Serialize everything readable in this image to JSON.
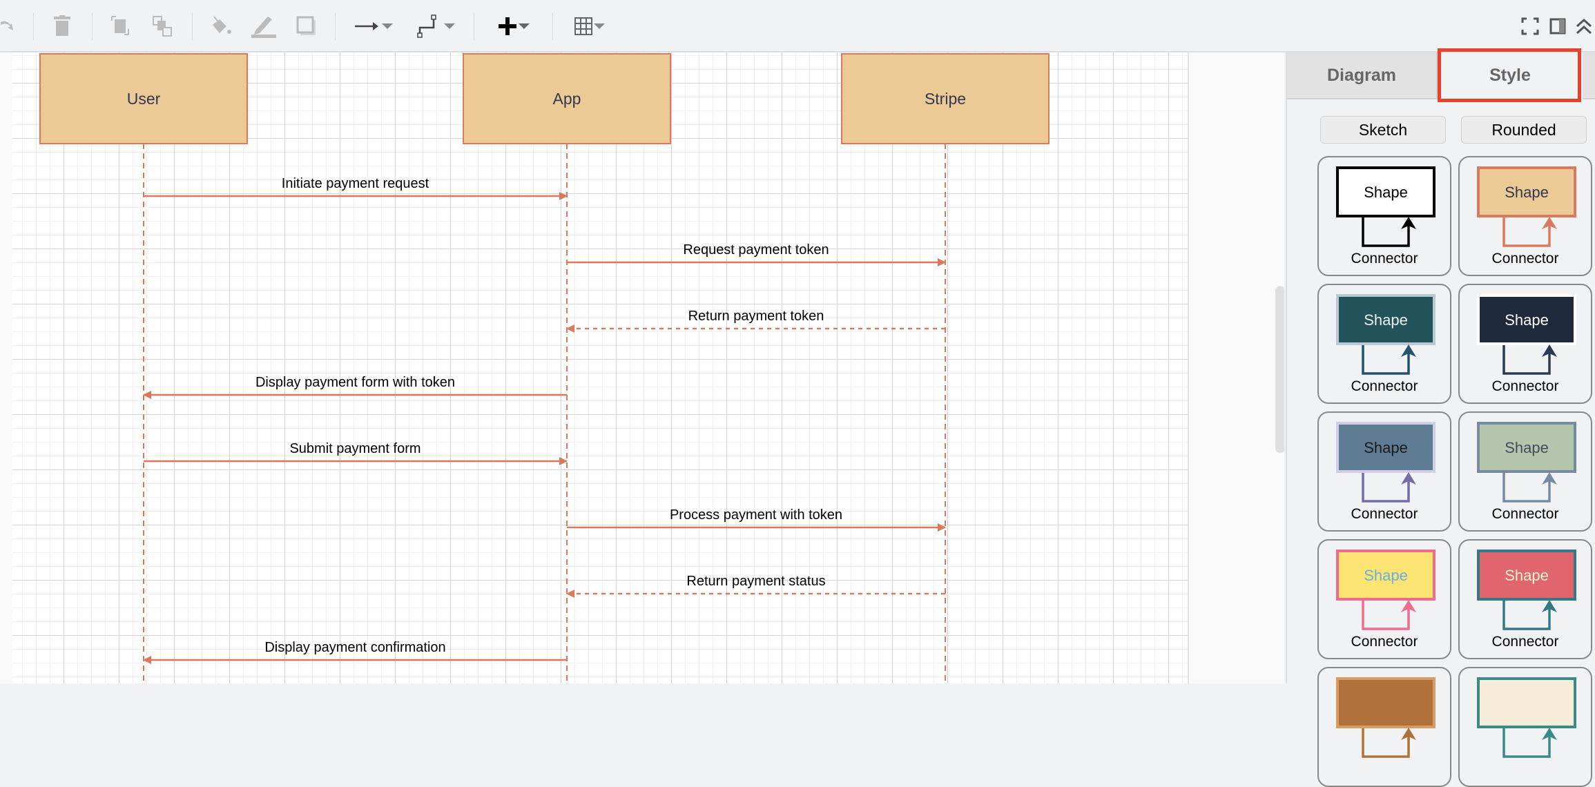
{
  "toolbar": {
    "items": [
      {
        "name": "redo-button",
        "icon": "redo-icon",
        "enabled": false
      },
      {
        "name": "delete-button",
        "icon": "trash-icon",
        "enabled": false
      },
      {
        "name": "to-front-button",
        "icon": "to-front-icon",
        "enabled": false
      },
      {
        "name": "to-back-button",
        "icon": "to-back-icon",
        "enabled": false
      },
      {
        "name": "fill-color-button",
        "icon": "paint-bucket-icon",
        "enabled": false
      },
      {
        "name": "line-color-button",
        "icon": "pencil-icon",
        "enabled": false
      },
      {
        "name": "shadow-button",
        "icon": "shadow-icon",
        "enabled": false
      },
      {
        "name": "connection-arrow-button",
        "icon": "arrow-right-icon",
        "enabled": true
      },
      {
        "name": "waypoints-button",
        "icon": "waypoint-icon",
        "enabled": true
      },
      {
        "name": "insert-button",
        "icon": "plus-icon",
        "enabled": true
      },
      {
        "name": "table-button",
        "icon": "table-icon",
        "enabled": true
      }
    ],
    "right_items": [
      {
        "name": "fullscreen-button",
        "icon": "fullscreen-icon"
      },
      {
        "name": "format-panel-button",
        "icon": "panel-icon"
      },
      {
        "name": "collapse-button",
        "icon": "chevrons-up-icon"
      }
    ]
  },
  "diagram": {
    "colors": {
      "participant_fill": "#ecca96",
      "participant_stroke": "#d97a5e",
      "participant_text": "#333650",
      "arrow": "#d97a5e",
      "label": "#000000"
    },
    "participants": [
      {
        "id": "user",
        "label": "User"
      },
      {
        "id": "app",
        "label": "App"
      },
      {
        "id": "stripe",
        "label": "Stripe"
      }
    ],
    "messages": [
      {
        "from": "user",
        "to": "app",
        "label": "Initiate payment request",
        "style": "solid"
      },
      {
        "from": "app",
        "to": "stripe",
        "label": "Request payment token",
        "style": "solid"
      },
      {
        "from": "stripe",
        "to": "app",
        "label": "Return payment token",
        "style": "dashed"
      },
      {
        "from": "app",
        "to": "user",
        "label": "Display payment form with token",
        "style": "solid"
      },
      {
        "from": "user",
        "to": "app",
        "label": "Submit payment form",
        "style": "solid"
      },
      {
        "from": "app",
        "to": "stripe",
        "label": "Process payment with token",
        "style": "solid"
      },
      {
        "from": "stripe",
        "to": "app",
        "label": "Return payment status",
        "style": "dashed"
      },
      {
        "from": "app",
        "to": "user",
        "label": "Display payment confirmation",
        "style": "solid"
      }
    ]
  },
  "sidebar": {
    "tabs": [
      {
        "label": "Diagram",
        "active": false
      },
      {
        "label": "Style",
        "active": true
      }
    ],
    "buttons": {
      "sketch": "Sketch",
      "rounded": "Rounded"
    },
    "styles": [
      {
        "shape_label": "Shape",
        "connector_label": "Connector",
        "fill": "#ffffff",
        "stroke": "#000000",
        "font": "#000000",
        "line": "#000000"
      },
      {
        "shape_label": "Shape",
        "connector_label": "Connector",
        "fill": "#ecca96",
        "stroke": "#d97a5e",
        "font": "#333650",
        "line": "#d97a5e"
      },
      {
        "shape_label": "Shape",
        "connector_label": "Connector",
        "fill": "#23535a",
        "stroke": "#bac8d3",
        "font": "#eeeeee",
        "line": "#23536b"
      },
      {
        "shape_label": "Shape",
        "connector_label": "Connector",
        "fill": "#1e2a3b",
        "stroke": "#ffffff",
        "font": "#ffffff",
        "line": "#283a55"
      },
      {
        "shape_label": "Shape",
        "connector_label": "Connector",
        "fill": "#5f7c95",
        "stroke": "#d0cee2",
        "font": "#1a1a1a",
        "line": "#736ca8"
      },
      {
        "shape_label": "Shape",
        "connector_label": "Connector",
        "fill": "#b5c6ad",
        "stroke": "#788aa3",
        "font": "#46495d",
        "line": "#788aa3"
      },
      {
        "shape_label": "Shape",
        "connector_label": "Connector",
        "fill": "#fce473",
        "stroke": "#f06c8f",
        "font": "#6aaee0",
        "line": "#f06c8f"
      },
      {
        "shape_label": "Shape",
        "connector_label": "Connector",
        "fill": "#e0656c",
        "stroke": "#347a86",
        "font": "#f3f1d6",
        "line": "#347a86"
      },
      {
        "shape_label": "",
        "connector_label": "",
        "fill": "#b1713a",
        "stroke": "#d69c61",
        "font": "#ffffff",
        "line": "#b1713a"
      },
      {
        "shape_label": "",
        "connector_label": "",
        "fill": "#f6ecd8",
        "stroke": "#3a8a8a",
        "font": "#000000",
        "line": "#3a8a8a"
      }
    ]
  }
}
